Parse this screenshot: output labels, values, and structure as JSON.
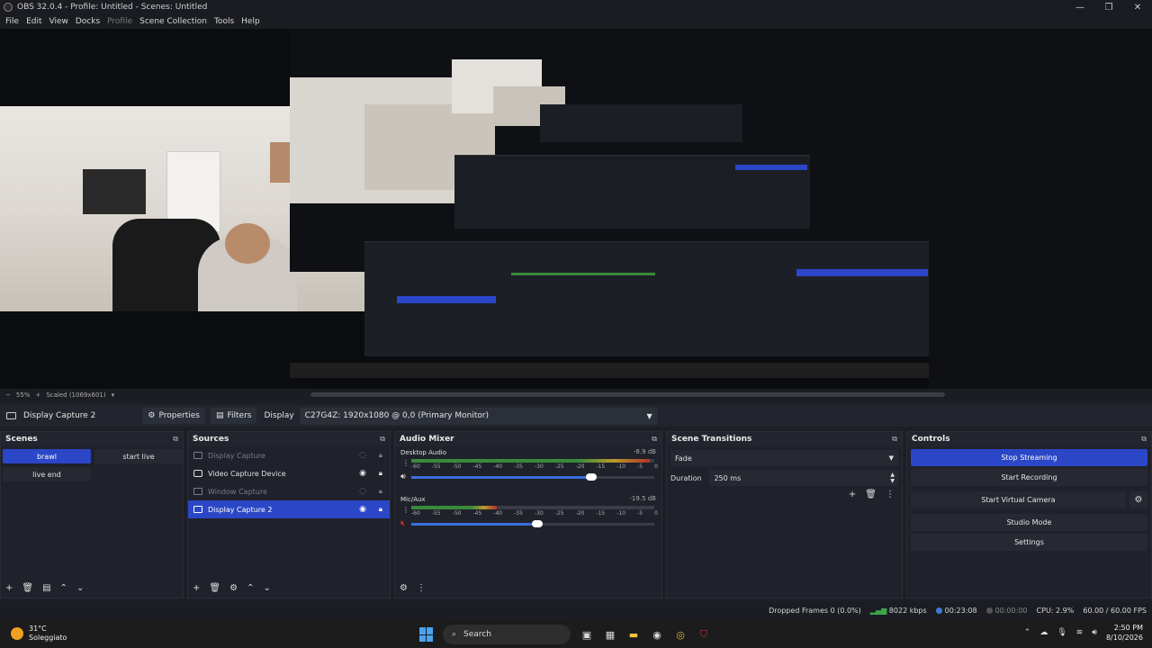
{
  "window": {
    "title": "OBS 32.0.4 - Profile: Untitled - Scenes: Untitled"
  },
  "menu": [
    {
      "label": "File",
      "enabled": true
    },
    {
      "label": "Edit",
      "enabled": true
    },
    {
      "label": "View",
      "enabled": true
    },
    {
      "label": "Docks",
      "enabled": true
    },
    {
      "label": "Profile",
      "enabled": false
    },
    {
      "label": "Scene Collection",
      "enabled": true
    },
    {
      "label": "Tools",
      "enabled": true
    },
    {
      "label": "Help",
      "enabled": true
    }
  ],
  "preview": {
    "zoom": "55%",
    "scaled": "Scaled (1069x601)"
  },
  "source_bar": {
    "selected_source": "Display Capture 2",
    "properties_label": "Properties",
    "filters_label": "Filters",
    "display_label": "Display",
    "display_value": "C27G4Z: 1920x1080 @ 0,0 (Primary Monitor)"
  },
  "scenes": {
    "title": "Scenes",
    "items": [
      {
        "label": "brawl",
        "active": true
      },
      {
        "label": "start live",
        "active": false
      },
      {
        "label": "live end",
        "active": false
      }
    ]
  },
  "sources": {
    "title": "Sources",
    "items": [
      {
        "label": "Display Capture",
        "icon": "monitor-icon",
        "visible": false,
        "active": false
      },
      {
        "label": "Video Capture Device",
        "icon": "camera-icon",
        "visible": true,
        "active": false
      },
      {
        "label": "Window Capture",
        "icon": "window-icon",
        "visible": false,
        "active": false
      },
      {
        "label": "Display Capture 2",
        "icon": "monitor-icon",
        "visible": true,
        "active": true
      }
    ]
  },
  "mixer": {
    "title": "Audio Mixer",
    "scale": [
      "-60",
      "-55",
      "-50",
      "-45",
      "-40",
      "-35",
      "-30",
      "-25",
      "-20",
      "-15",
      "-10",
      "-5",
      "0"
    ],
    "channels": [
      {
        "name": "Desktop Audio",
        "db": "-8.9 dB",
        "level": 0.98,
        "volume": 0.74
      },
      {
        "name": "Mic/Aux",
        "db": "-19.5 dB",
        "level": 0.35,
        "volume": 0.52
      }
    ]
  },
  "transitions": {
    "title": "Scene Transitions",
    "selected": "Fade",
    "duration_label": "Duration",
    "duration_value": "250 ms"
  },
  "controls": {
    "title": "Controls",
    "stop_streaming": "Stop Streaming",
    "start_recording": "Start Recording",
    "start_virtual_camera": "Start Virtual Camera",
    "studio_mode": "Studio Mode",
    "settings": "Settings"
  },
  "status": {
    "dropped_frames": "Dropped Frames 0 (0.0%)",
    "bitrate": "8022 kbps",
    "stream_time": "00:23:08",
    "rec_time": "00:00:00",
    "cpu": "CPU: 2.9%",
    "fps": "60.00 / 60.00 FPS"
  },
  "taskbar": {
    "temperature": "31°C",
    "weather": "Soleggiato",
    "search_label": "Search",
    "time": "2:50 PM",
    "date": "8/10/2026"
  },
  "colors": {
    "accent": "#2b46c7",
    "panel": "#1f222a",
    "background": "#1d1f26"
  }
}
